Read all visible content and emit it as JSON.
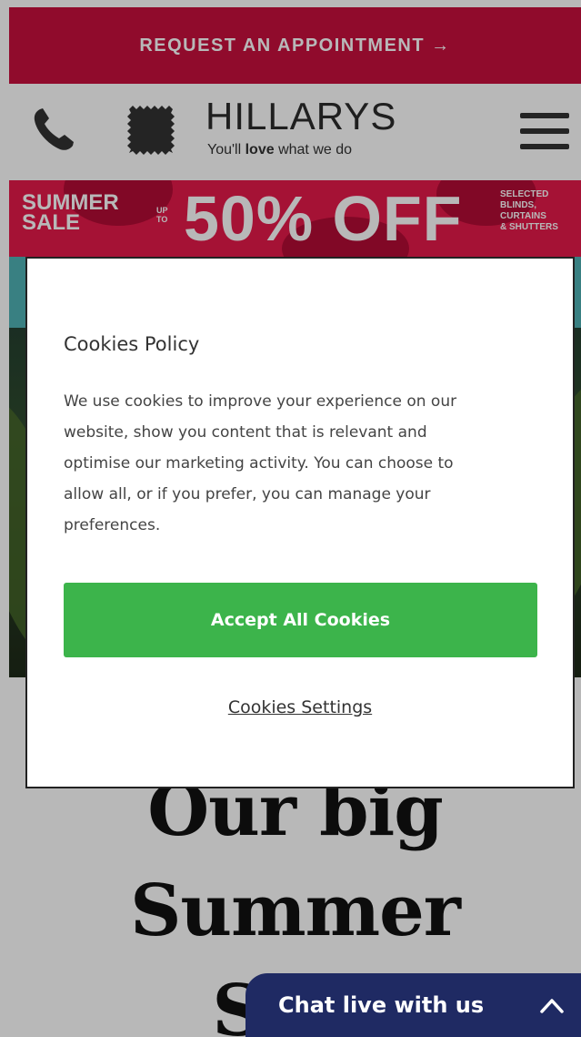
{
  "top_bar": {
    "appointment_label": "REQUEST AN APPOINTMENT →"
  },
  "header": {
    "logo_word": "HILLARYS",
    "tagline_pre": "You'll ",
    "tagline_bold": "love",
    "tagline_post": " what we do",
    "icons": [
      "phone-icon",
      "fabric-swatch-icon",
      "menu-icon"
    ]
  },
  "sale_banner": {
    "left_line1": "SUMMER",
    "left_line2": "SALE",
    "upto_line1": "UP",
    "upto_line2": "TO",
    "headline": "50% OFF",
    "right_line1": "SELECTED",
    "right_line2": "BLINDS,",
    "right_line3": "CURTAINS",
    "right_line4": "& SHUTTERS"
  },
  "page": {
    "headline_line1": "Our big",
    "headline_line2": "Summer",
    "headline_line3": "Sale"
  },
  "cookie_modal": {
    "title": "Cookies Policy",
    "body_line1": "We use cookies to improve your experience on our",
    "body_line2": "website, show you content that is relevant and",
    "body_line3": "optimise our marketing activity. You can choose to",
    "body_line4": "allow all, or if you prefer, you can manage your",
    "body_line5": "preferences.",
    "accept_label": "Accept All Cookies",
    "settings_label": "Cookies Settings"
  },
  "chat": {
    "label": "Chat live with us"
  },
  "colors": {
    "brand_red": "#c8103e",
    "sale_red": "#e5194a",
    "accept_green": "#3cb44b",
    "chat_navy": "#1f2a63"
  }
}
